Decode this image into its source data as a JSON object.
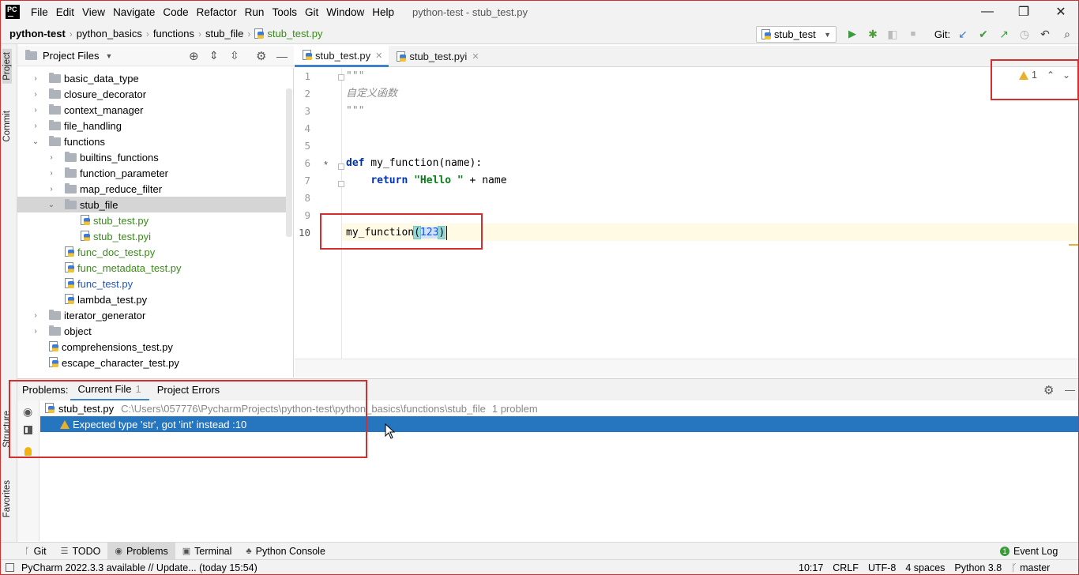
{
  "window": {
    "app_logo": "PC",
    "title": "python-test - stub_test.py",
    "menu": [
      "File",
      "Edit",
      "View",
      "Navigate",
      "Code",
      "Refactor",
      "Run",
      "Tools",
      "Git",
      "Window",
      "Help"
    ],
    "minimize": "—",
    "restore": "❐",
    "close": "✕"
  },
  "breadcrumbs": [
    "python-test",
    "python_basics",
    "functions",
    "stub_file",
    "stub_test.py"
  ],
  "run_config": "stub_test",
  "git_label": "Git:",
  "left_stripe": {
    "project": "Project",
    "commit": "Commit",
    "structure": "Structure",
    "favorites": "Favorites"
  },
  "project_panel": {
    "title": "Project Files",
    "tree": [
      {
        "label": "basic_data_type",
        "type": "folder",
        "depth": 0,
        "expanded": false
      },
      {
        "label": "closure_decorator",
        "type": "folder",
        "depth": 0,
        "expanded": false
      },
      {
        "label": "context_manager",
        "type": "folder",
        "depth": 0,
        "expanded": false
      },
      {
        "label": "file_handling",
        "type": "folder",
        "depth": 0,
        "expanded": false
      },
      {
        "label": "functions",
        "type": "folder",
        "depth": 0,
        "expanded": true
      },
      {
        "label": "builtins_functions",
        "type": "folder",
        "depth": 1,
        "expanded": false
      },
      {
        "label": "function_parameter",
        "type": "folder",
        "depth": 1,
        "expanded": false
      },
      {
        "label": "map_reduce_filter",
        "type": "folder",
        "depth": 1,
        "expanded": false
      },
      {
        "label": "stub_file",
        "type": "folder",
        "depth": 1,
        "expanded": true,
        "selected": true
      },
      {
        "label": "stub_test.py",
        "type": "file",
        "depth": 2,
        "color": "#3a8a1a"
      },
      {
        "label": "stub_test.pyi",
        "type": "file",
        "depth": 2,
        "color": "#3a8a1a"
      },
      {
        "label": "func_doc_test.py",
        "type": "file",
        "depth": 1,
        "color": "#3a8a1a"
      },
      {
        "label": "func_metadata_test.py",
        "type": "file",
        "depth": 1,
        "color": "#3a8a1a"
      },
      {
        "label": "func_test.py",
        "type": "file",
        "depth": 1,
        "color": "#2255b8"
      },
      {
        "label": "lambda_test.py",
        "type": "file",
        "depth": 1,
        "color": "#000000"
      },
      {
        "label": "iterator_generator",
        "type": "folder",
        "depth": 0,
        "expanded": false
      },
      {
        "label": "object",
        "type": "folder",
        "depth": 0,
        "expanded": false
      },
      {
        "label": "comprehensions_test.py",
        "type": "file",
        "depth": 0,
        "color": "#000000"
      },
      {
        "label": "escape_character_test.py",
        "type": "file",
        "depth": 0,
        "color": "#000000"
      }
    ]
  },
  "editor": {
    "tabs": [
      {
        "label": "stub_test.py",
        "active": true
      },
      {
        "label": "stub_test.pyi",
        "active": false
      }
    ],
    "line_numbers": [
      "1",
      "2",
      "3",
      "4",
      "5",
      "6",
      "7",
      "8",
      "9",
      "10"
    ],
    "lines": [
      [
        {
          "t": "\"\"\"",
          "c": "cm"
        }
      ],
      [
        {
          "t": "自定义函数",
          "c": "cm"
        }
      ],
      [
        {
          "t": "\"\"\"",
          "c": "cm"
        }
      ],
      [],
      [],
      [
        {
          "t": "def",
          "c": "kw"
        },
        {
          "t": " my_function(name):",
          "c": ""
        }
      ],
      [
        {
          "t": "    ",
          "c": ""
        },
        {
          "t": "return",
          "c": "kw"
        },
        {
          "t": " ",
          "c": ""
        },
        {
          "t": "\"Hello \"",
          "c": "str"
        },
        {
          "t": " + name",
          "c": ""
        }
      ],
      [],
      [],
      [
        {
          "t": "my_function",
          "c": ""
        },
        {
          "t": "(",
          "c": "br"
        },
        {
          "t": "123",
          "c": "num"
        },
        {
          "t": ")",
          "c": "br"
        }
      ]
    ],
    "gutter_mark": "*",
    "inspection_count": "1"
  },
  "problems": {
    "label": "Problems:",
    "tabs": [
      {
        "label": "Current File",
        "count": "1",
        "active": true
      },
      {
        "label": "Project Errors",
        "count": "",
        "active": false
      }
    ],
    "file": "stub_test.py",
    "path": "C:\\Users\\057776\\PycharmProjects\\python-test\\python_basics\\functions\\stub_file",
    "summary": "1 problem",
    "message": "Expected type 'str', got 'int' instead :10"
  },
  "tool_windows": [
    "Git",
    "TODO",
    "Problems",
    "Terminal",
    "Python Console"
  ],
  "event_log": "Event Log",
  "status": {
    "message": "PyCharm 2022.3.3 available // Update... (today 15:54)",
    "position": "10:17",
    "line_sep": "CRLF",
    "encoding": "UTF-8",
    "indent": "4 spaces",
    "interpreter": "Python 3.8",
    "branch": "master"
  }
}
